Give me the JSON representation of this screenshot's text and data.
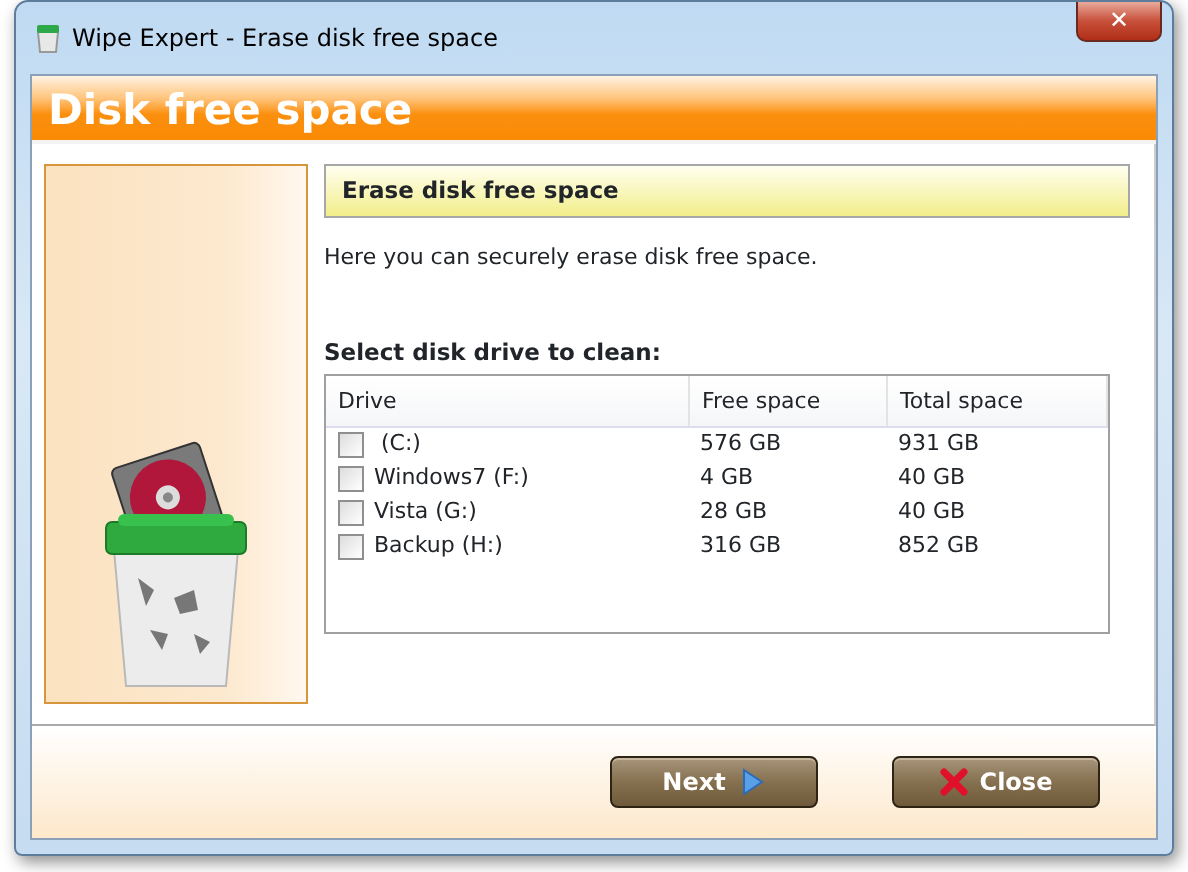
{
  "window": {
    "title": "Wipe Expert - Erase disk free space",
    "close_glyph": "✕"
  },
  "header": {
    "title": "Disk free space"
  },
  "panel": {
    "title": "Erase disk free space",
    "description": "Here you can securely erase disk free space.",
    "list_label": "Select disk drive to clean:"
  },
  "table": {
    "columns": [
      "Drive",
      "Free space",
      "Total space"
    ],
    "rows": [
      {
        "drive": " (C:)",
        "free": "576 GB",
        "total": "931 GB",
        "checked": false
      },
      {
        "drive": "Windows7 (F:)",
        "free": "4 GB",
        "total": "40 GB",
        "checked": false
      },
      {
        "drive": "Vista (G:)",
        "free": "28 GB",
        "total": "40 GB",
        "checked": false
      },
      {
        "drive": "Backup (H:)",
        "free": "316 GB",
        "total": "852 GB",
        "checked": false
      }
    ]
  },
  "buttons": [
    {
      "label": "Next",
      "kind": "next"
    },
    {
      "label": "Close",
      "kind": "close"
    }
  ]
}
